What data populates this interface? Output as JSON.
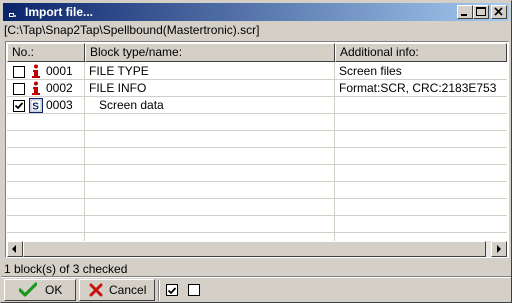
{
  "window": {
    "title": "Import file...",
    "path": "[C:\\Tap\\Snap2Tap\\Spellbound(Mastertronic).scr]"
  },
  "titlebar_buttons": [
    {
      "name": "minimize-button",
      "icon": "minimize-icon"
    },
    {
      "name": "maximize-button",
      "icon": "maximize-icon"
    },
    {
      "name": "close-button",
      "icon": "close-icon"
    }
  ],
  "columns": {
    "no": "No.:",
    "block": "Block type/name:",
    "info": "Additional info:"
  },
  "rows": [
    {
      "checked": false,
      "icon": "info-icon",
      "no": "0001",
      "block": "FILE TYPE",
      "info": "Screen files"
    },
    {
      "checked": false,
      "icon": "info-icon",
      "no": "0002",
      "block": "FILE INFO",
      "info": "Format:SCR,  CRC:2183E753"
    },
    {
      "checked": true,
      "icon": "screen-icon",
      "no": "0003",
      "block": "Screen data",
      "info": ""
    }
  ],
  "status": "1 block(s) of 3 checked",
  "buttons": {
    "ok": "OK",
    "cancel": "Cancel"
  },
  "colors": {
    "title_start": "#0a246a",
    "title_end": "#a6caf0",
    "face": "#d4d0c8",
    "ok_green": "#1a9a1a",
    "cancel_red": "#c81010",
    "info_red": "#c00000"
  }
}
